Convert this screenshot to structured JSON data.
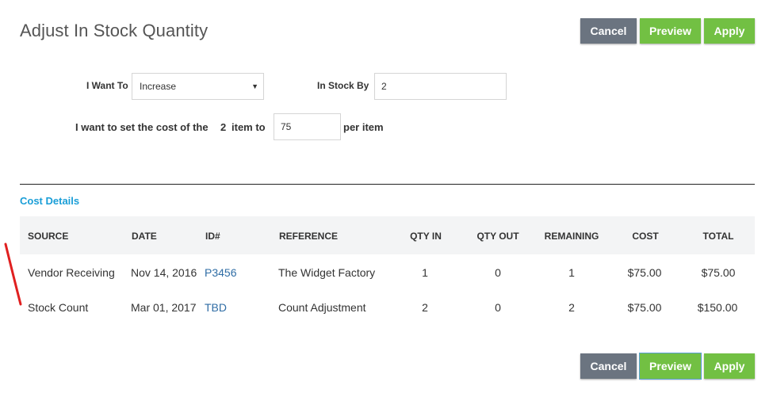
{
  "page": {
    "title": "Adjust In Stock Quantity"
  },
  "actions": {
    "cancel": "Cancel",
    "preview": "Preview",
    "apply": "Apply"
  },
  "form": {
    "want_to_label": "I Want To",
    "want_to_value": "Increase",
    "in_stock_by_label": "In Stock By",
    "in_stock_by_value": "2",
    "cost_sentence_prefix": "I want to set the cost of the",
    "cost_sentence_qty": "2",
    "cost_sentence_middle": "item to",
    "cost_value": "75",
    "cost_sentence_suffix": "per item"
  },
  "cost_details": {
    "title": "Cost Details",
    "columns": [
      "SOURCE",
      "DATE",
      "ID#",
      "REFERENCE",
      "QTY IN",
      "QTY OUT",
      "REMAINING",
      "COST",
      "TOTAL"
    ],
    "rows": [
      {
        "source": "Vendor Receiving",
        "date": "Nov 14, 2016",
        "id": "P3456",
        "reference": "The Widget Factory",
        "qty_in": "1",
        "qty_out": "0",
        "remaining": "1",
        "cost": "$75.00",
        "total": "$75.00"
      },
      {
        "source": "Stock Count",
        "date": "Mar 01, 2017",
        "id": "TBD",
        "reference": "Count Adjustment",
        "qty_in": "2",
        "qty_out": "0",
        "remaining": "2",
        "cost": "$75.00",
        "total": "$150.00"
      }
    ]
  },
  "colors": {
    "cancel": "#6b7480",
    "green": "#72c043",
    "link": "#2f6da5",
    "section_title": "#1a9ed7",
    "annotation": "#e02020"
  }
}
